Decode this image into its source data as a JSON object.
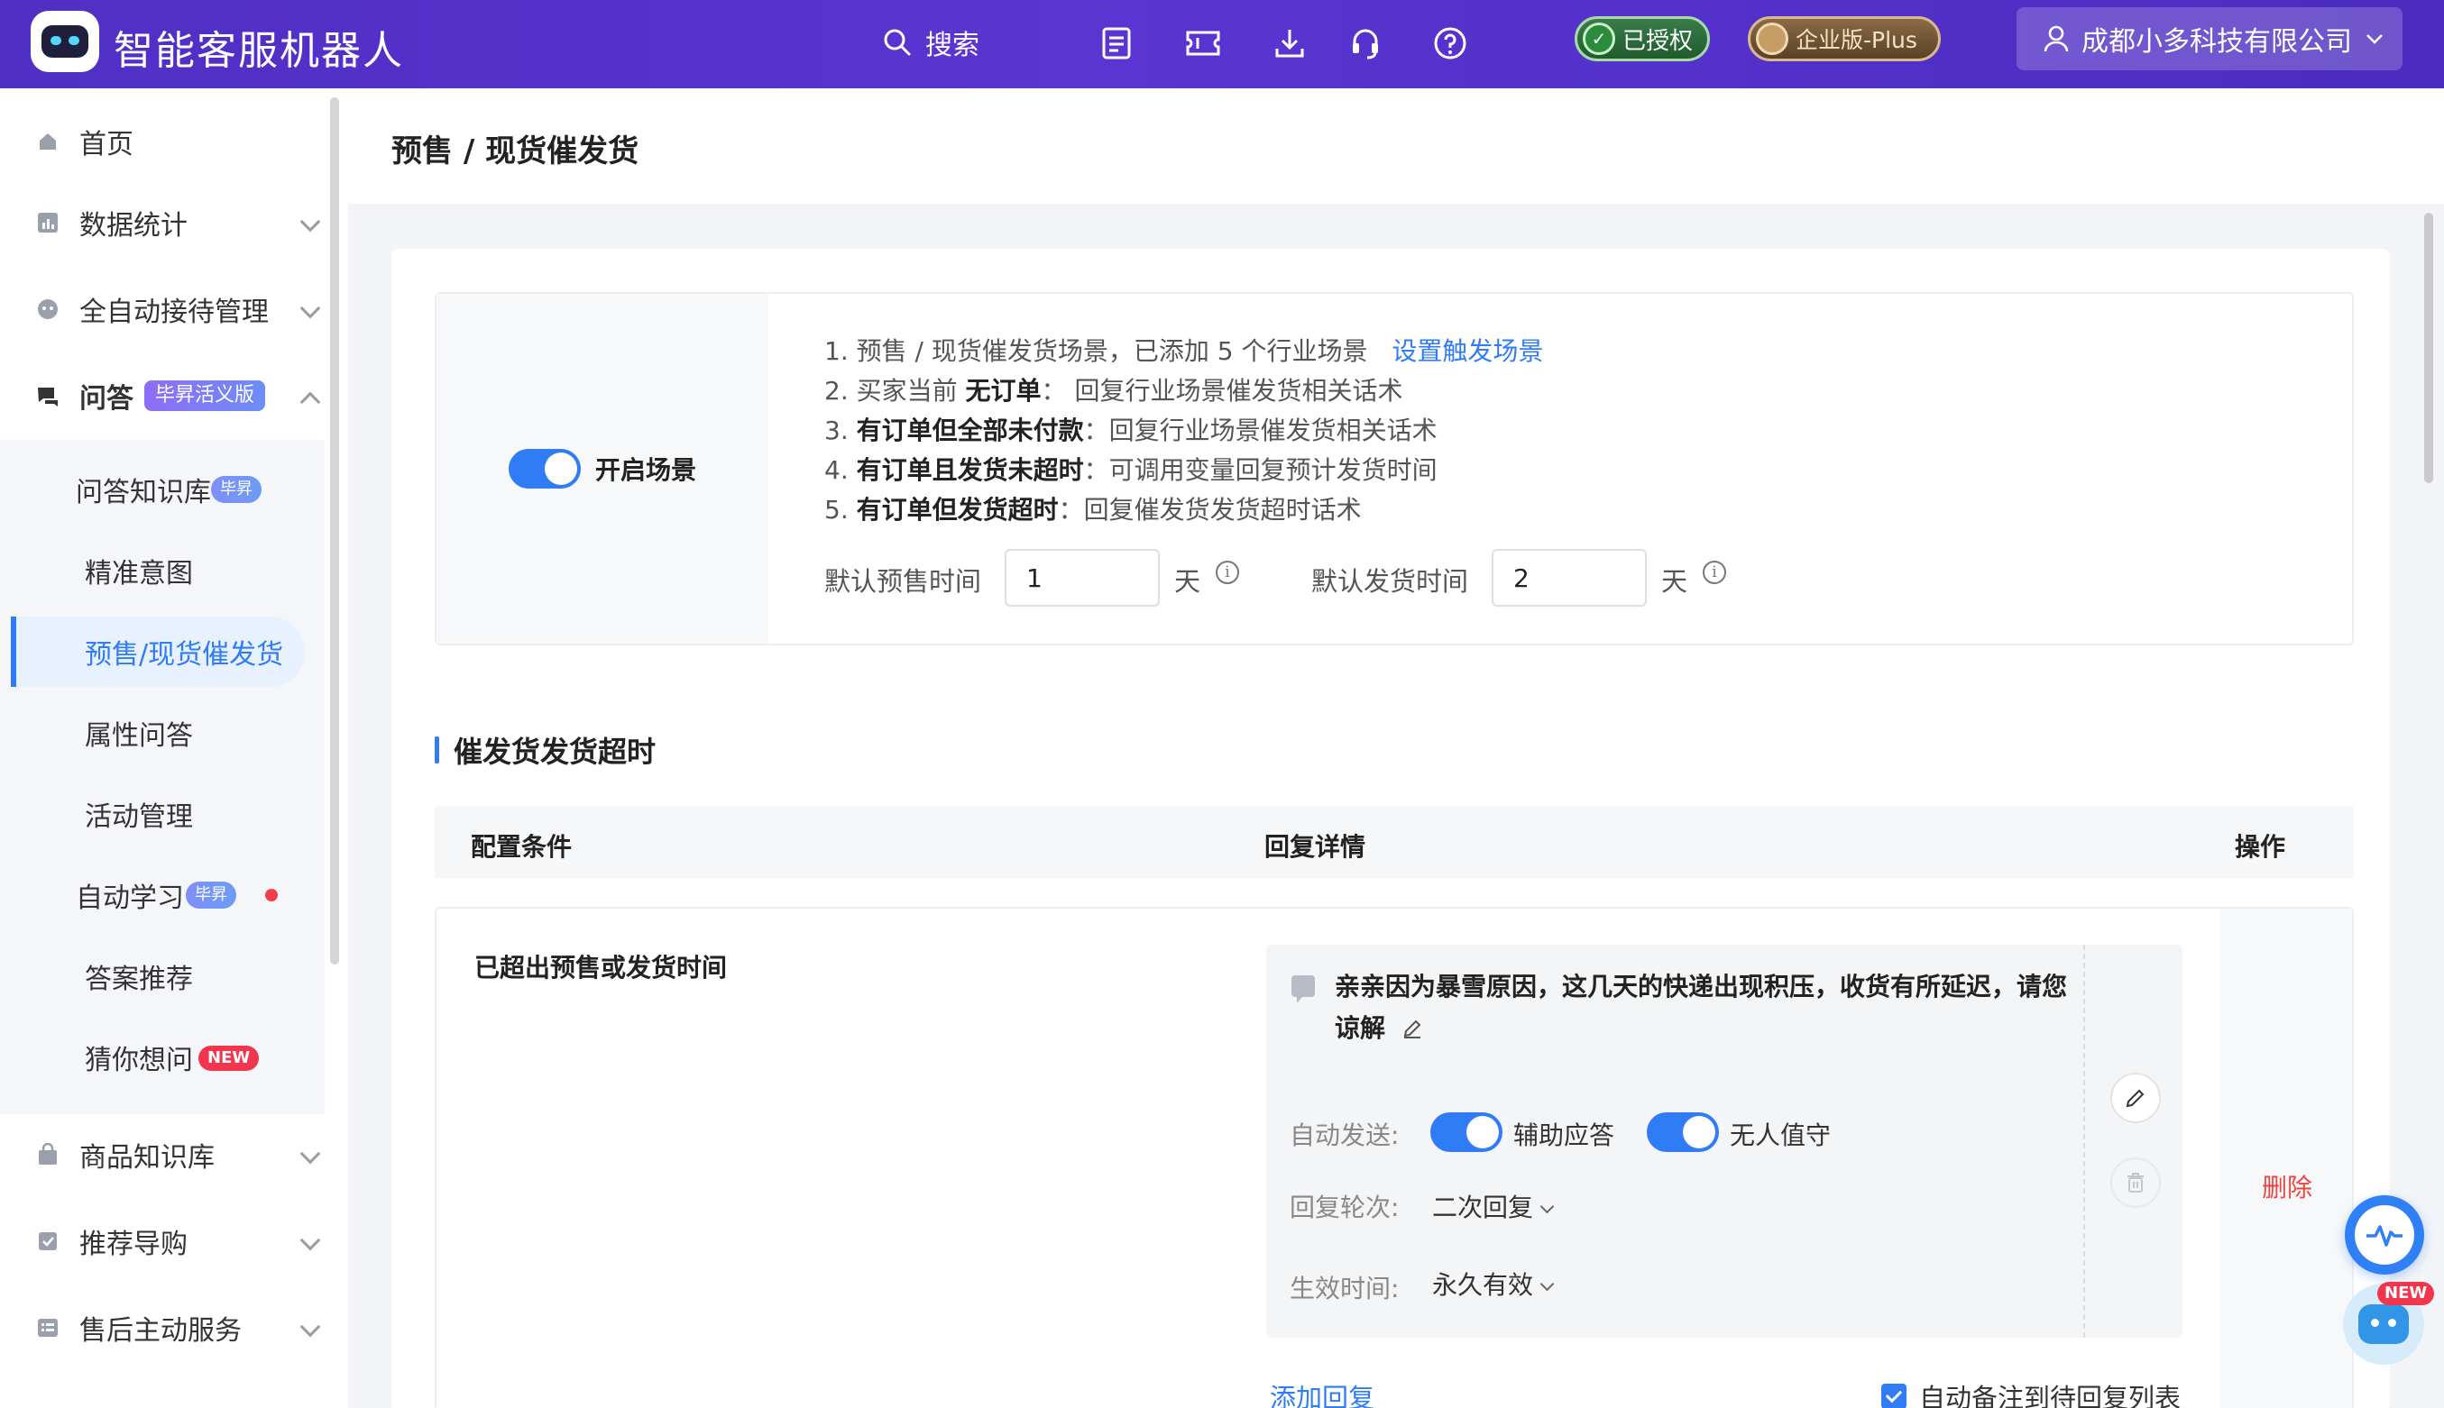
{
  "app": {
    "title": "智能客服机器人"
  },
  "header": {
    "search_label": "搜索",
    "icons": [
      "list-icon",
      "ticket-icon",
      "download-icon",
      "headset-icon",
      "help-icon"
    ],
    "auth_badge": "已授权",
    "edition_badge": "企业版-Plus",
    "company": "成都小多科技有限公司"
  },
  "sidebar": {
    "items": [
      {
        "label": "首页",
        "icon": "home-icon"
      },
      {
        "label": "数据统计",
        "icon": "chart-icon"
      },
      {
        "label": "全自动接待管理",
        "icon": "bot-icon"
      },
      {
        "label": "问答",
        "icon": "chat-icon",
        "tag": "毕昇活义版"
      },
      {
        "label": "商品知识库",
        "icon": "bag-icon"
      },
      {
        "label": "推荐导购",
        "icon": "guide-icon"
      },
      {
        "label": "售后主动服务",
        "icon": "service-icon"
      }
    ],
    "sub_items": [
      {
        "label": "问答知识库",
        "tag": "毕昇"
      },
      {
        "label": "精准意图"
      },
      {
        "label": "预售/现货催发货"
      },
      {
        "label": "属性问答"
      },
      {
        "label": "活动管理"
      },
      {
        "label": "自动学习",
        "tag": "毕昇"
      },
      {
        "label": "答案推荐"
      },
      {
        "label": "猜你想问",
        "tag": "NEW"
      }
    ],
    "active_sub": "预售/现货催发货"
  },
  "main": {
    "page_title": "预售 / 现货催发货",
    "scene": {
      "toggle_label": "开启场景",
      "enabled": true,
      "rules": [
        {
          "prefix": "1. 预售 / 现货催发货场景，已添加 5 个行业场景",
          "link": "设置触发场景"
        },
        {
          "prefix": "2. 买家当前 ",
          "bold": "无订单",
          "suffix": "： 回复行业场景催发货相关话术"
        },
        {
          "prefix": "3. ",
          "bold": "有订单但全部未付款",
          "suffix": "：回复行业场景催发货相关话术"
        },
        {
          "prefix": "4. ",
          "bold": "有订单且发货未超时",
          "suffix": "：可调用变量回复预计发货时间"
        },
        {
          "prefix": "5. ",
          "bold": "有订单但发货超时",
          "suffix": "：回复催发货发货超时话术"
        }
      ],
      "presale_label": "默认预售时间",
      "presale_value": "1",
      "presale_unit": "天",
      "ship_label": "默认发货时间",
      "ship_value": "2",
      "ship_unit": "天"
    },
    "section_title": "催发货发货超时",
    "table": {
      "headers": [
        "配置条件",
        "回复详情",
        "操作"
      ],
      "rows": [
        {
          "condition": "已超出预售或发货时间",
          "reply_text": "亲亲因为暴雪原因，这几天的快递出现积压，收货有所延迟，请您谅解",
          "auto_send_label": "自动发送:",
          "assist_label": "辅助应答",
          "unattended_label": "无人值守",
          "round_label": "回复轮次:",
          "round_value": "二次回复",
          "effective_label": "生效时间:",
          "effective_value": "永久有效",
          "delete_label": "删除"
        }
      ]
    },
    "add_reply": "添加回复",
    "auto_note": "自动备注到待回复列表"
  },
  "floating": {
    "new_tag": "NEW"
  },
  "colors": {
    "brand": "#5a35d2",
    "accent": "#2f7cf6",
    "danger": "#f0443f"
  }
}
